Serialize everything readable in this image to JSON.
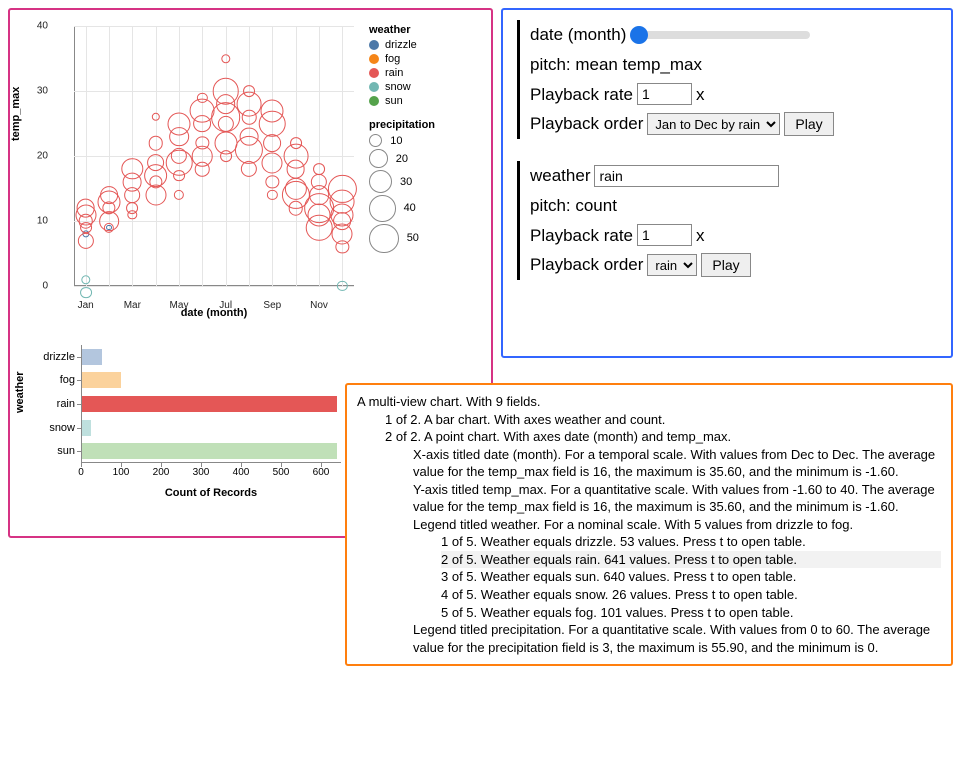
{
  "chart_data": [
    {
      "type": "point",
      "title": "",
      "xlabel": "date (month)",
      "ylabel": "temp_max",
      "ylim": [
        0,
        40
      ],
      "y_ticks": [
        0,
        10,
        20,
        30,
        40
      ],
      "categories": [
        "Jan",
        "Feb",
        "Mar",
        "Apr",
        "May",
        "Jun",
        "Jul",
        "Aug",
        "Sep",
        "Oct",
        "Nov",
        "Dec"
      ],
      "x_ticks": [
        "Jan",
        "Mar",
        "May",
        "Jul",
        "Sep",
        "Nov"
      ],
      "legend_weather": {
        "title": "weather",
        "items": [
          {
            "name": "drizzle",
            "color": "#4c78a8"
          },
          {
            "name": "fog",
            "color": "#f58518"
          },
          {
            "name": "rain",
            "color": "#e45756"
          },
          {
            "name": "snow",
            "color": "#72b7b2"
          },
          {
            "name": "sun",
            "color": "#54a24b"
          }
        ]
      },
      "legend_precip": {
        "title": "precipitation",
        "sizes": [
          10,
          20,
          30,
          40,
          50
        ]
      },
      "series": [
        {
          "weather": "snow",
          "month": "Jan",
          "temp_max": 1,
          "precip": 5
        },
        {
          "weather": "snow",
          "month": "Jan",
          "temp_max": -1,
          "precip": 8
        },
        {
          "weather": "snow",
          "month": "Dec",
          "temp_max": 0,
          "precip": 6
        },
        {
          "weather": "drizzle",
          "month": "Jan",
          "temp_max": 8,
          "precip": 3
        },
        {
          "weather": "drizzle",
          "month": "Feb",
          "temp_max": 9,
          "precip": 2
        },
        {
          "weather": "rain",
          "month": "Jan",
          "temp_max": 10,
          "precip": 12
        },
        {
          "weather": "rain",
          "month": "Jan",
          "temp_max": 12,
          "precip": 20
        },
        {
          "weather": "rain",
          "month": "Jan",
          "temp_max": 9,
          "precip": 8
        },
        {
          "weather": "rain",
          "month": "Jan",
          "temp_max": 11,
          "precip": 25
        },
        {
          "weather": "rain",
          "month": "Jan",
          "temp_max": 7,
          "precip": 15
        },
        {
          "weather": "rain",
          "month": "Feb",
          "temp_max": 12,
          "precip": 10
        },
        {
          "weather": "rain",
          "month": "Feb",
          "temp_max": 14,
          "precip": 18
        },
        {
          "weather": "rain",
          "month": "Feb",
          "temp_max": 10,
          "precip": 22
        },
        {
          "weather": "rain",
          "month": "Feb",
          "temp_max": 9,
          "precip": 6
        },
        {
          "weather": "rain",
          "month": "Feb",
          "temp_max": 13,
          "precip": 30
        },
        {
          "weather": "rain",
          "month": "Mar",
          "temp_max": 14,
          "precip": 14
        },
        {
          "weather": "rain",
          "month": "Mar",
          "temp_max": 16,
          "precip": 20
        },
        {
          "weather": "rain",
          "month": "Mar",
          "temp_max": 12,
          "precip": 8
        },
        {
          "weather": "rain",
          "month": "Mar",
          "temp_max": 18,
          "precip": 26
        },
        {
          "weather": "rain",
          "month": "Mar",
          "temp_max": 11,
          "precip": 5
        },
        {
          "weather": "rain",
          "month": "Apr",
          "temp_max": 16,
          "precip": 10
        },
        {
          "weather": "rain",
          "month": "Apr",
          "temp_max": 19,
          "precip": 18
        },
        {
          "weather": "rain",
          "month": "Apr",
          "temp_max": 14,
          "precip": 25
        },
        {
          "weather": "rain",
          "month": "Apr",
          "temp_max": 22,
          "precip": 12
        },
        {
          "weather": "rain",
          "month": "Apr",
          "temp_max": 26,
          "precip": 4
        },
        {
          "weather": "rain",
          "month": "Apr",
          "temp_max": 17,
          "precip": 32
        },
        {
          "weather": "rain",
          "month": "May",
          "temp_max": 20,
          "precip": 15
        },
        {
          "weather": "rain",
          "month": "May",
          "temp_max": 23,
          "precip": 22
        },
        {
          "weather": "rain",
          "month": "May",
          "temp_max": 17,
          "precip": 8
        },
        {
          "weather": "rain",
          "month": "May",
          "temp_max": 25,
          "precip": 30
        },
        {
          "weather": "rain",
          "month": "May",
          "temp_max": 19,
          "precip": 40
        },
        {
          "weather": "rain",
          "month": "May",
          "temp_max": 14,
          "precip": 6
        },
        {
          "weather": "rain",
          "month": "Jun",
          "temp_max": 22,
          "precip": 10
        },
        {
          "weather": "rain",
          "month": "Jun",
          "temp_max": 25,
          "precip": 18
        },
        {
          "weather": "rain",
          "month": "Jun",
          "temp_max": 20,
          "precip": 24
        },
        {
          "weather": "rain",
          "month": "Jun",
          "temp_max": 27,
          "precip": 35
        },
        {
          "weather": "rain",
          "month": "Jun",
          "temp_max": 18,
          "precip": 12
        },
        {
          "weather": "rain",
          "month": "Jun",
          "temp_max": 29,
          "precip": 6
        },
        {
          "weather": "rain",
          "month": "Jul",
          "temp_max": 25,
          "precip": 15
        },
        {
          "weather": "rain",
          "month": "Jul",
          "temp_max": 28,
          "precip": 22
        },
        {
          "weather": "rain",
          "month": "Jul",
          "temp_max": 22,
          "precip": 30
        },
        {
          "weather": "rain",
          "month": "Jul",
          "temp_max": 30,
          "precip": 40
        },
        {
          "weather": "rain",
          "month": "Jul",
          "temp_max": 20,
          "precip": 8
        },
        {
          "weather": "rain",
          "month": "Jul",
          "temp_max": 35,
          "precip": 5
        },
        {
          "weather": "rain",
          "month": "Jul",
          "temp_max": 26,
          "precip": 50
        },
        {
          "weather": "rain",
          "month": "Aug",
          "temp_max": 26,
          "precip": 12
        },
        {
          "weather": "rain",
          "month": "Aug",
          "temp_max": 23,
          "precip": 20
        },
        {
          "weather": "rain",
          "month": "Aug",
          "temp_max": 28,
          "precip": 35
        },
        {
          "weather": "rain",
          "month": "Aug",
          "temp_max": 21,
          "precip": 45
        },
        {
          "weather": "rain",
          "month": "Aug",
          "temp_max": 30,
          "precip": 8
        },
        {
          "weather": "rain",
          "month": "Aug",
          "temp_max": 18,
          "precip": 15
        },
        {
          "weather": "rain",
          "month": "Sep",
          "temp_max": 22,
          "precip": 18
        },
        {
          "weather": "rain",
          "month": "Sep",
          "temp_max": 19,
          "precip": 25
        },
        {
          "weather": "rain",
          "month": "Sep",
          "temp_max": 25,
          "precip": 40
        },
        {
          "weather": "rain",
          "month": "Sep",
          "temp_max": 16,
          "precip": 10
        },
        {
          "weather": "rain",
          "month": "Sep",
          "temp_max": 27,
          "precip": 30
        },
        {
          "weather": "rain",
          "month": "Sep",
          "temp_max": 14,
          "precip": 6
        },
        {
          "weather": "rain",
          "month": "Oct",
          "temp_max": 18,
          "precip": 20
        },
        {
          "weather": "rain",
          "month": "Oct",
          "temp_max": 15,
          "precip": 28
        },
        {
          "weather": "rain",
          "month": "Oct",
          "temp_max": 20,
          "precip": 35
        },
        {
          "weather": "rain",
          "month": "Oct",
          "temp_max": 12,
          "precip": 12
        },
        {
          "weather": "rain",
          "month": "Oct",
          "temp_max": 22,
          "precip": 8
        },
        {
          "weather": "rain",
          "month": "Oct",
          "temp_max": 14,
          "precip": 45
        },
        {
          "weather": "rain",
          "month": "Nov",
          "temp_max": 14,
          "precip": 22
        },
        {
          "weather": "rain",
          "month": "Nov",
          "temp_max": 11,
          "precip": 30
        },
        {
          "weather": "rain",
          "month": "Nov",
          "temp_max": 16,
          "precip": 15
        },
        {
          "weather": "rain",
          "month": "Nov",
          "temp_max": 9,
          "precip": 40
        },
        {
          "weather": "rain",
          "month": "Nov",
          "temp_max": 18,
          "precip": 8
        },
        {
          "weather": "rain",
          "month": "Nov",
          "temp_max": 12,
          "precip": 50
        },
        {
          "weather": "rain",
          "month": "Dec",
          "temp_max": 10,
          "precip": 18
        },
        {
          "weather": "rain",
          "month": "Dec",
          "temp_max": 8,
          "precip": 25
        },
        {
          "weather": "rain",
          "month": "Dec",
          "temp_max": 13,
          "precip": 35
        },
        {
          "weather": "rain",
          "month": "Dec",
          "temp_max": 6,
          "precip": 10
        },
        {
          "weather": "rain",
          "month": "Dec",
          "temp_max": 15,
          "precip": 45
        },
        {
          "weather": "rain",
          "month": "Dec",
          "temp_max": 11,
          "precip": 30
        }
      ]
    },
    {
      "type": "bar",
      "orientation": "horizontal",
      "xlabel": "Count of Records",
      "ylabel": "weather",
      "categories": [
        "drizzle",
        "fog",
        "rain",
        "snow",
        "sun"
      ],
      "values": [
        53,
        101,
        641,
        26,
        640
      ],
      "colors": [
        "#b3c6de",
        "#fbd29c",
        "#e45756",
        "#bfe0de",
        "#c0e0b8"
      ],
      "xlim": [
        0,
        650
      ],
      "x_ticks": [
        0,
        100,
        200,
        300,
        400,
        500,
        600
      ]
    }
  ],
  "controls": {
    "block1": {
      "line1_label": "date (month)",
      "line2": "pitch: mean temp_max",
      "rate_label": "Playback rate",
      "rate_value": "1",
      "rate_suffix": "x",
      "order_label": "Playback order",
      "order_value": "Jan to Dec by rain",
      "play": "Play"
    },
    "block2": {
      "line1_label": "weather",
      "line1_value": "rain",
      "line2": "pitch: count",
      "rate_label": "Playback rate",
      "rate_value": "1",
      "rate_suffix": "x",
      "order_label": "Playback order",
      "order_value": "rain",
      "play": "Play"
    }
  },
  "description": {
    "l0": "A multi-view chart. With 9 fields.",
    "l1": "1 of 2. A bar chart. With axes weather and count.",
    "l2": "2 of 2. A point chart. With axes date (month) and temp_max.",
    "l3": "X-axis titled date (month). For a temporal scale. With values from Dec to Dec. The average value for the temp_max field is 16, the maximum is 35.60, and the minimum is -1.60.",
    "l4": "Y-axis titled temp_max. For a quantitative scale. With values from -1.60 to 40. The average value for the temp_max field is 16, the maximum is 35.60, and the minimum is -1.60.",
    "l5": "Legend titled weather. For a nominal scale. With 5 values from drizzle to fog.",
    "l6": "1 of 5. Weather equals drizzle. 53 values. Press t to open table.",
    "l7": "2 of 5. Weather equals rain. 641 values. Press t to open table.",
    "l8": "3 of 5. Weather equals sun. 640 values. Press t to open table.",
    "l9": "4 of 5. Weather equals snow. 26 values. Press t to open table.",
    "l10": "5 of 5. Weather equals fog. 101 values. Press t to open table.",
    "l11": "Legend titled precipitation. For a quantitative scale. With values from 0 to 60. The average value for the precipitation field is 3, the maximum is 55.90, and the minimum is 0."
  }
}
